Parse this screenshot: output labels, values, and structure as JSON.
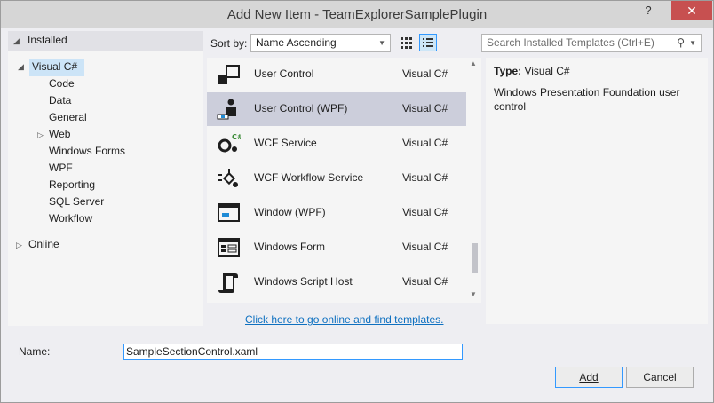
{
  "window": {
    "title": "Add New Item - TeamExplorerSamplePlugin",
    "help": "?",
    "close": "✕"
  },
  "tree": {
    "installed": "Installed",
    "visual_csharp": "Visual C#",
    "children": [
      "Code",
      "Data",
      "General",
      "Web",
      "Windows Forms",
      "WPF",
      "Reporting",
      "SQL Server",
      "Workflow"
    ],
    "online": "Online"
  },
  "toolbar": {
    "sort_by_label": "Sort by:",
    "sort_value": "Name Ascending",
    "search_placeholder": "Search Installed Templates (Ctrl+E)"
  },
  "templates": [
    {
      "name": "User Control",
      "lang": "Visual C#",
      "icon": "user-control-icon"
    },
    {
      "name": "User Control (WPF)",
      "lang": "Visual C#",
      "icon": "user-control-wpf-icon",
      "selected": true
    },
    {
      "name": "WCF Service",
      "lang": "Visual C#",
      "icon": "wcf-service-icon"
    },
    {
      "name": "WCF Workflow Service",
      "lang": "Visual C#",
      "icon": "wcf-workflow-icon"
    },
    {
      "name": "Window (WPF)",
      "lang": "Visual C#",
      "icon": "window-wpf-icon"
    },
    {
      "name": "Windows Form",
      "lang": "Visual C#",
      "icon": "windows-form-icon"
    },
    {
      "name": "Windows Script Host",
      "lang": "Visual C#",
      "icon": "script-host-icon"
    }
  ],
  "online_link": "Click here to go online and find templates.",
  "details": {
    "type_label": "Type:",
    "type_value": "Visual C#",
    "description": "Windows Presentation Foundation user control"
  },
  "name_field": {
    "label": "Name:",
    "value": "SampleSectionControl.xaml"
  },
  "buttons": {
    "add": "Add",
    "cancel": "Cancel"
  },
  "colors": {
    "selected_row": "#cccedb",
    "tree_selected": "#cce4f7",
    "link": "#0e70c0",
    "accent": "#3399ff"
  }
}
